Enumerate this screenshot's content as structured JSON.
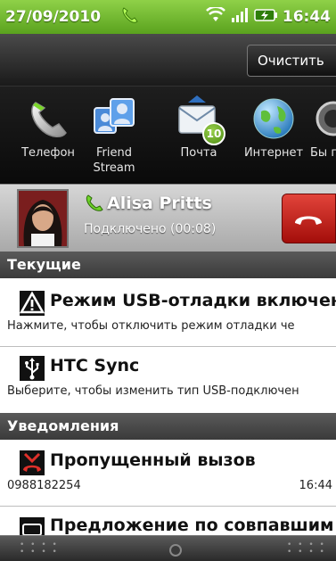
{
  "status_bar": {
    "date": "27/09/2010",
    "time": "16:44",
    "icons": [
      "call-in-progress-icon",
      "wifi-icon",
      "signal-icon",
      "battery-charging-icon"
    ]
  },
  "toolbar": {
    "clear_label": "Очистить"
  },
  "quick_apps": [
    {
      "label": "Телефон",
      "icon": "phone-icon"
    },
    {
      "label": "Friend Stream",
      "icon": "friend-stream-icon"
    },
    {
      "label": "Почта",
      "icon": "mail-icon",
      "badge": "10"
    },
    {
      "label": "Интернет",
      "icon": "globe-icon"
    },
    {
      "label": "Бы п",
      "icon": "app-icon"
    }
  ],
  "active_call": {
    "name": "Alisa Pritts",
    "status": "Подключено (00:08)"
  },
  "sections": {
    "current": "Текущие",
    "notifications": "Уведомления"
  },
  "current_items": [
    {
      "title": "Режим USB-отладки включен",
      "subtitle": "Нажмите, чтобы отключить режим отладки че",
      "icon": "warning-icon"
    },
    {
      "title": "HTC Sync",
      "subtitle": "Выберите, чтобы изменить тип USB-подключен",
      "icon": "usb-icon"
    }
  ],
  "notification_items": [
    {
      "title": "Пропущенный вызов",
      "subtitle": "0988182254",
      "time": "16:44",
      "icon": "missed-call-icon"
    },
    {
      "title": "Предложение по совпавшим",
      "icon": "contact-card-icon"
    }
  ],
  "colors": {
    "status_bar": "#6fb82a",
    "end_call": "#c8201a",
    "badge": "#6aa81f"
  }
}
